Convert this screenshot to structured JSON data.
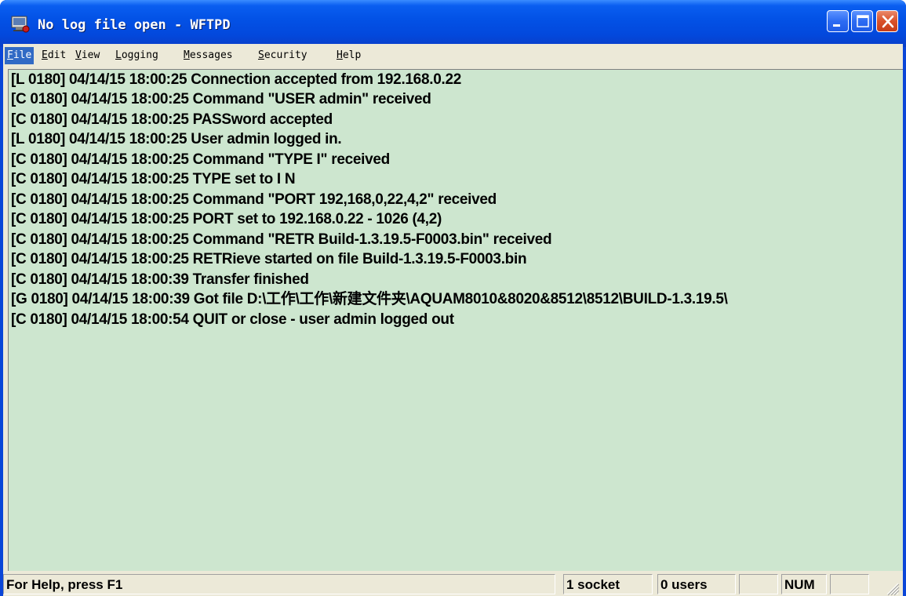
{
  "window": {
    "title": "No log file open - WFTPD"
  },
  "menu": {
    "items": [
      {
        "mnemonic": "F",
        "rest": "ile"
      },
      {
        "mnemonic": "E",
        "rest": "dit"
      },
      {
        "mnemonic": "V",
        "rest": "iew"
      },
      {
        "mnemonic": "L",
        "rest": "ogging"
      },
      {
        "mnemonic": "M",
        "rest": "essages"
      },
      {
        "mnemonic": "S",
        "rest": "ecurity"
      },
      {
        "mnemonic": "H",
        "rest": "elp"
      }
    ]
  },
  "log": {
    "lines": [
      "[L 0180] 04/14/15 18:00:25 Connection accepted from 192.168.0.22",
      "[C 0180] 04/14/15 18:00:25 Command \"USER admin\" received",
      "[C 0180] 04/14/15 18:00:25 PASSword accepted",
      "[L 0180] 04/14/15 18:00:25 User admin logged in.",
      "[C 0180] 04/14/15 18:00:25 Command \"TYPE I\" received",
      "[C 0180] 04/14/15 18:00:25 TYPE set to I N",
      "[C 0180] 04/14/15 18:00:25 Command \"PORT 192,168,0,22,4,2\" received",
      "[C 0180] 04/14/15 18:00:25 PORT set to 192.168.0.22 - 1026 (4,2)",
      "[C 0180] 04/14/15 18:00:25 Command \"RETR Build-1.3.19.5-F0003.bin\" received",
      "[C 0180] 04/14/15 18:00:25 RETRieve started on file Build-1.3.19.5-F0003.bin",
      "[C 0180] 04/14/15 18:00:39 Transfer finished",
      "[G 0180] 04/14/15 18:00:39 Got file D:\\工作\\工作\\新建文件夹\\AQUAM8010&8020&8512\\8512\\BUILD-1.3.19.5\\",
      "[C 0180] 04/14/15 18:00:54 QUIT or close - user admin logged out"
    ]
  },
  "status": {
    "help": "For Help, press F1",
    "sockets": "1 socket",
    "users": "0 users",
    "blank": "",
    "num": "NUM",
    "blank2": ""
  },
  "colors": {
    "log_background": "#cde6cf",
    "titlebar": "#0352e6",
    "menu_highlight": "#316ac5"
  },
  "icons": {
    "app": "wftpd-app-icon",
    "minimize": "minimize-icon",
    "maximize": "maximize-icon",
    "close": "close-icon",
    "grip": "resize-grip-icon"
  }
}
